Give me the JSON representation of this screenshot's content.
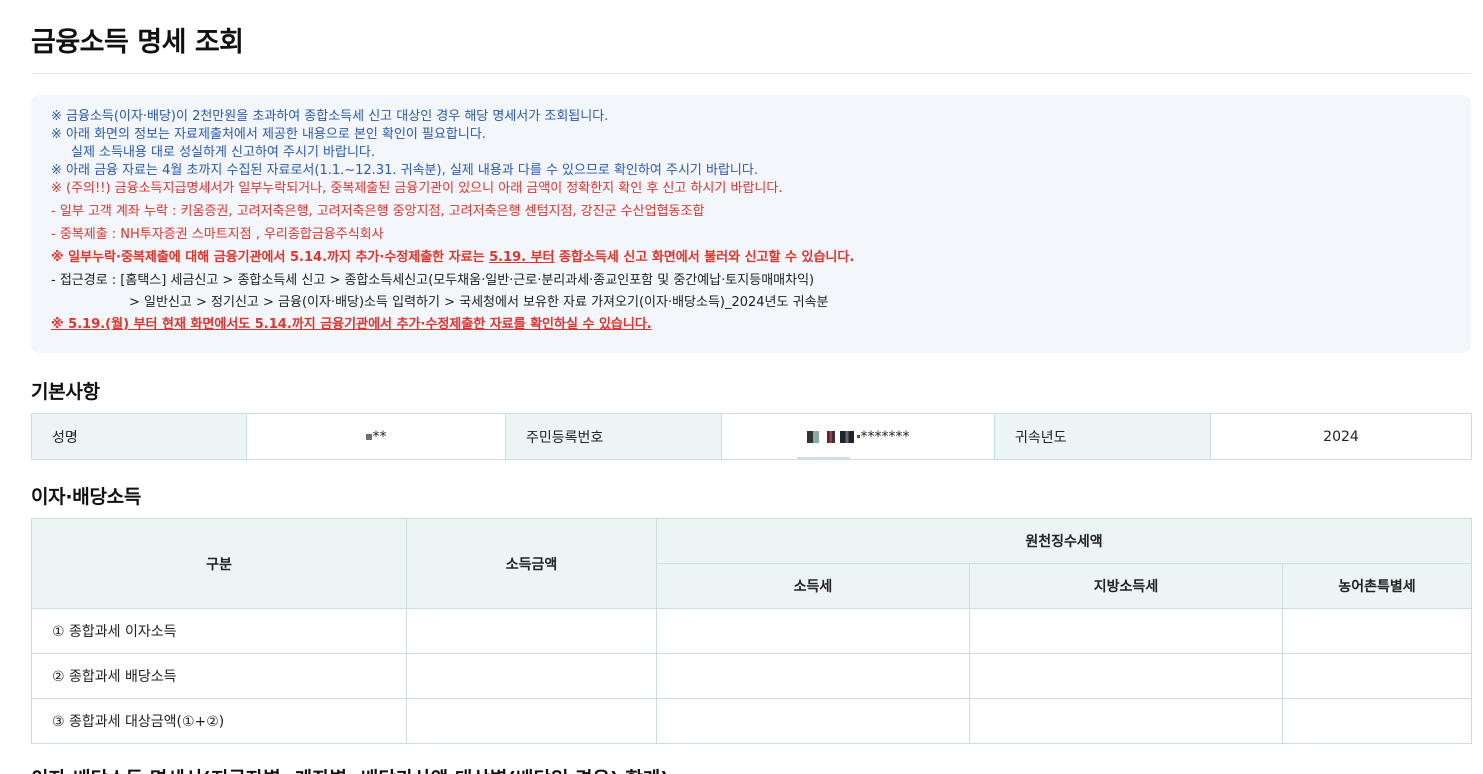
{
  "page": {
    "title": "금융소득 명세 조회"
  },
  "notice": {
    "lines": [
      "※ 금융소득(이자·배당)이 2천만원을 초과하여 종합소득세 신고 대상인 경우 해당 명세서가 조회됩니다.",
      "※ 아래 화면의 정보는 자료제출처에서 제공한 내용으로 본인 확인이 필요합니다.",
      "실제 소득내용 대로 성실하게 신고하여 주시기 바랍니다.",
      "※ 아래 금융 자료는 4월 초까지 수집된 자료로서(1.1.~12.31. 귀속분), 실제 내용과 다를 수 있으므로 확인하여 주시기 바랍니다.",
      "※ (주의!!) 금융소득지급명세서가 일부누락되거나, 중복제출된 금융기관이 있으니 아래 금액이 정확한지 확인 후 신고 하시기 바랍니다.",
      "- 일부 고객 계좌 누락 : 키움증권, 고려저축은행, 고려저축은행 중앙지점, 고려저축은행 센텀지점, 강진군 수산업협동조합",
      "- 중복제출 : NH투자증권 스마트지점 , 우리종합금융주식회사",
      "※ 일부누락·중복제출에 대해 금융기관에서 5.14.까지 추가·수정제출한 자료는 ",
      "5.19. 부터",
      " 종합소득세 신고 화면에서 불러와 신고할 수 있습니다.",
      "- 접근경로 : [홈택스] 세금신고 > 종합소득세 신고 > 종합소득세신고(모두채움·일반·근로·분리과세·종교인포함 및 중간예납·토지등매매차익)",
      "> 일반신고 > 정기신고 > 금융(이자·배당)소득 입력하기 > 국세청에서 보유한 자료 가져오기(이자·배당소득)_2024년도 귀속분",
      "※ 5.19.(월) 부터 현재 화면에서도 5.14.까지 금융기관에서 추가·수정제출한 자료를 확인하실 수 있습니다."
    ]
  },
  "basic": {
    "section_title": "기본사항",
    "name_label": "성명",
    "name_value": "**",
    "rrn_label": "주민등록번호",
    "rrn_value": "*******",
    "year_label": "귀속년도",
    "year_value": "2024"
  },
  "income": {
    "section_title": "이자·배당소득",
    "headers": {
      "category": "구분",
      "income_amount": "소득금액",
      "withholding": "원천징수세액",
      "income_tax": "소득세",
      "local_tax": "지방소득세",
      "rural_tax": "농어촌특별세"
    },
    "rows": [
      {
        "label": "① 종합과세 이자소득"
      },
      {
        "label": "② 종합과세 배당소득"
      },
      {
        "label": "③ 종합과세 대상금액(①+②)"
      }
    ]
  },
  "next_section": {
    "title": "이자·배당소득 명세서(지급자별, 계좌별, 배당가산액 대상별(배당인 경우) 합계)"
  }
}
